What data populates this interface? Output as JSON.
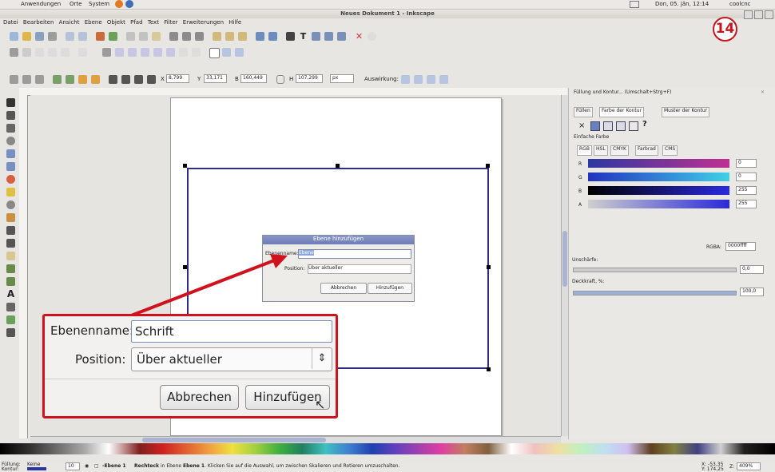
{
  "panel": {
    "menus": [
      "Anwendungen",
      "Orte",
      "System"
    ],
    "clock": "Don, 05. jän, 12:14",
    "user": "coolcnc"
  },
  "window": {
    "title": "Neues Dokument 1 - Inkscape"
  },
  "menubar": [
    "Datei",
    "Bearbeiten",
    "Ansicht",
    "Ebene",
    "Objekt",
    "Pfad",
    "Text",
    "Filter",
    "Erweiterungen",
    "Hilfe"
  ],
  "toolbar": {
    "x_label": "X",
    "x_value": "8,799",
    "y_label": "Y",
    "y_value": "33,171",
    "b_label": "B",
    "b_value": "160,449",
    "h_label": "H",
    "h_value": "107,299",
    "unit": "px",
    "auswirkung": "Auswirkung:"
  },
  "badge": "14",
  "dialog": {
    "title": "Ebene hinzufügen",
    "name_label": "Ebenenname:",
    "name_value": "Ebene",
    "position_label": "Position:",
    "position_value": "Über aktueller",
    "cancel": "Abbrechen",
    "add": "Hinzufügen"
  },
  "zoom": {
    "name_label": "Ebenenname:",
    "name_value": "Schrift",
    "position_label": "Position:",
    "position_value": "Über aktueller",
    "cancel": "Abbrechen",
    "add": "Hinzufügen"
  },
  "fillstroke": {
    "title": "Füllung und Kontur... (Umschalt+Strg+F)",
    "tabs": [
      "Füllen",
      "Farbe der Kontur",
      "Muster der Kontur"
    ],
    "paint_unknown": "?",
    "flat_color": "Einfache Farbe",
    "modes": [
      "RGB",
      "HSL",
      "CMYK",
      "Farbrad",
      "CMS"
    ],
    "channels": [
      {
        "label": "R",
        "value": "0"
      },
      {
        "label": "G",
        "value": "0"
      },
      {
        "label": "B",
        "value": "255"
      },
      {
        "label": "A",
        "value": "255"
      }
    ],
    "rgba_label": "RGBA:",
    "rgba_value": "0000ffff",
    "blur_label": "Unschärfe:",
    "blur_value": "0,0",
    "opacity_label": "Deckkraft, %:",
    "opacity_value": "100,0"
  },
  "status": {
    "fill_label": "Füllung:",
    "stroke_label": "Kontur:",
    "fill_value": "Keine",
    "stroke_width": "10",
    "layer": "-Ebene 1",
    "message_bold": "Rechteck",
    "message_mid": "in Ebene",
    "message_layer": "Ebene 1",
    "message_rest": ". Klicken Sie auf die Auswahl, um zwischen Skalieren und Rotieren umzuschalten.",
    "coord_x": "X: -53,35",
    "coord_y": "Y: 174,25",
    "zoom_label": "Z:",
    "zoom_value": "409%"
  }
}
